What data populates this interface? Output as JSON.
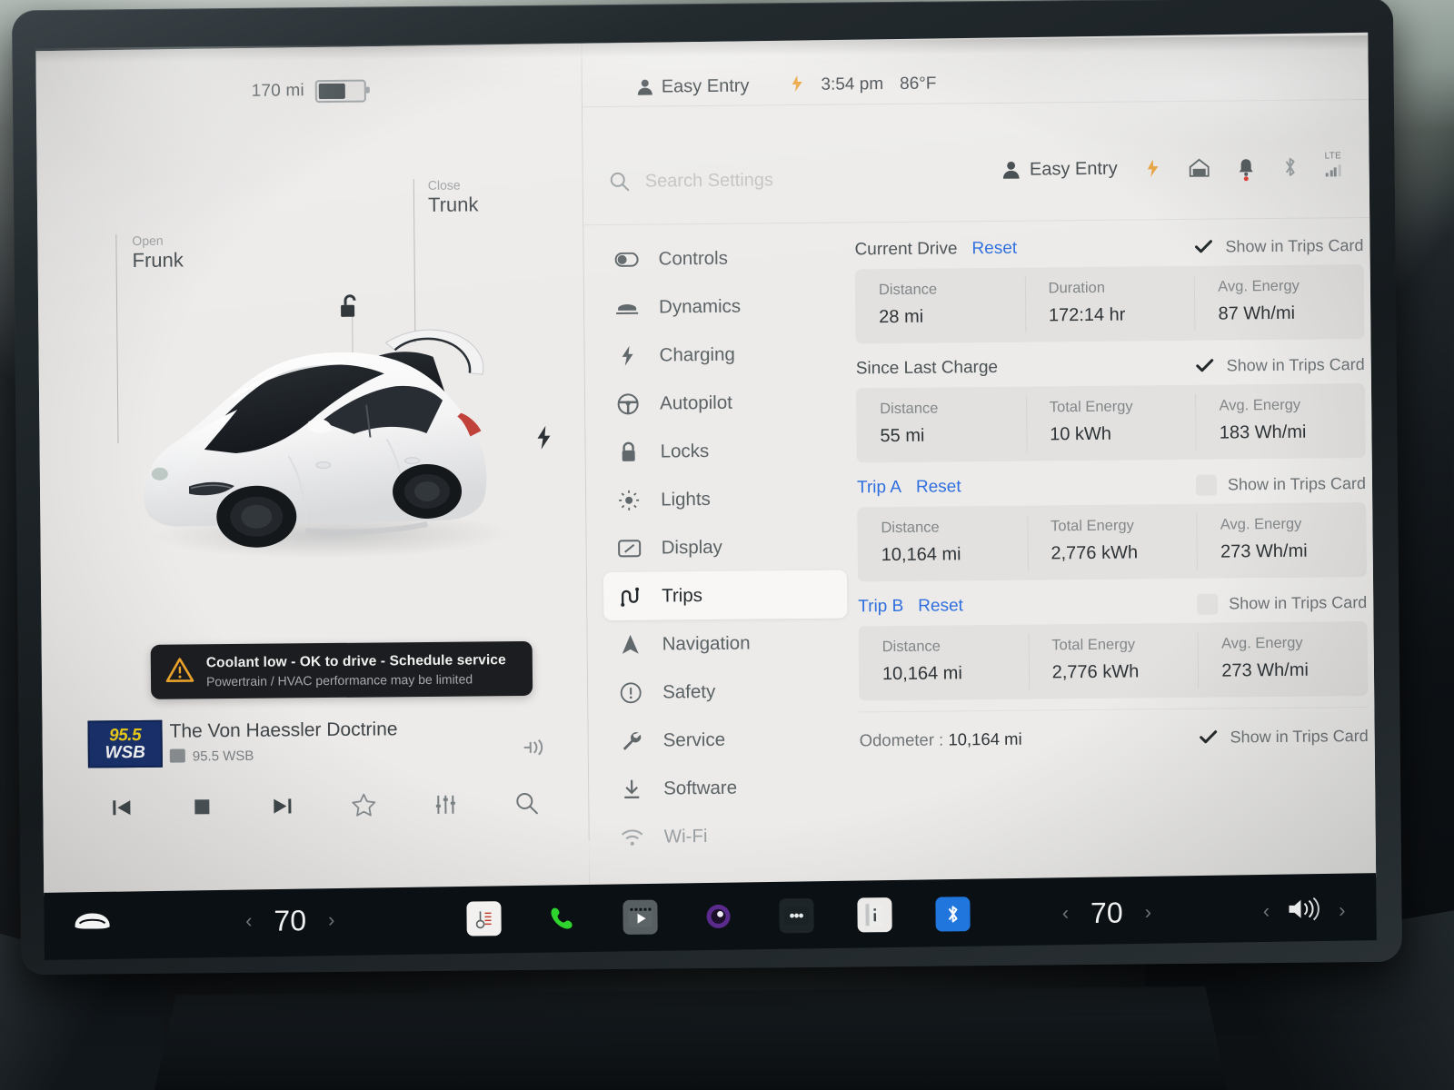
{
  "vehicle_status": {
    "range": "170 mi",
    "battery_percent": 55
  },
  "car_view": {
    "frunk": {
      "action": "Open",
      "label": "Frunk"
    },
    "trunk": {
      "action": "Close",
      "label": "Trunk"
    },
    "lock_icon": "unlocked-padlock-icon",
    "charge_icon": "charge-port-bolt-icon"
  },
  "alert": {
    "title": "Coolant low - OK to drive - Schedule service",
    "subtitle": "Powertrain / HVAC performance may be limited",
    "icon": "warning-triangle-icon",
    "icon_color": "#f0a62a"
  },
  "media": {
    "station_logo_top": "95.5",
    "station_logo_bottom": "WSB",
    "logo_bg": "#17306e",
    "logo_top_color": "#f7d417",
    "track_title": "The Von Haessler Doctrine",
    "station_name": "95.5 WSB",
    "controls": [
      {
        "name": "previous-track-button",
        "icon": "skip-previous-icon"
      },
      {
        "name": "stop-button",
        "icon": "stop-square-icon"
      },
      {
        "name": "next-track-button",
        "icon": "skip-next-icon"
      },
      {
        "name": "favorite-button",
        "icon": "star-outline-icon"
      },
      {
        "name": "equalizer-button",
        "icon": "sliders-icon"
      },
      {
        "name": "search-media-button",
        "icon": "search-icon"
      }
    ],
    "source_icon": "audio-source-icon"
  },
  "status_bar": {
    "profile": "Easy Entry",
    "clock": "3:54 pm",
    "outside_temp": "86°F",
    "icons": [
      "person-icon",
      "charge-cable-icon",
      "garage-door-icon",
      "bell-icon",
      "bluetooth-icon",
      "lte-signal-icon"
    ],
    "lte_label": "LTE"
  },
  "search": {
    "placeholder": "Search Settings",
    "icon": "search-icon"
  },
  "nav": {
    "items": [
      {
        "label": "Controls",
        "icon": "toggle-switch-icon",
        "active": false,
        "faded": false
      },
      {
        "label": "Dynamics",
        "icon": "car-suspension-icon",
        "active": false,
        "faded": false
      },
      {
        "label": "Charging",
        "icon": "lightning-bolt-icon",
        "active": false,
        "faded": false
      },
      {
        "label": "Autopilot",
        "icon": "steering-wheel-icon",
        "active": false,
        "faded": false
      },
      {
        "label": "Locks",
        "icon": "padlock-icon",
        "active": false,
        "faded": false
      },
      {
        "label": "Lights",
        "icon": "sun-lights-icon",
        "active": false,
        "faded": false
      },
      {
        "label": "Display",
        "icon": "screen-icon",
        "active": false,
        "faded": false
      },
      {
        "label": "Trips",
        "icon": "winding-road-icon",
        "active": true,
        "faded": false
      },
      {
        "label": "Navigation",
        "icon": "navigation-arrow-icon",
        "active": false,
        "faded": false
      },
      {
        "label": "Safety",
        "icon": "exclamation-circle-icon",
        "active": false,
        "faded": false
      },
      {
        "label": "Service",
        "icon": "wrench-icon",
        "active": false,
        "faded": false
      },
      {
        "label": "Software",
        "icon": "download-icon",
        "active": false,
        "faded": false
      },
      {
        "label": "Wi-Fi",
        "icon": "wifi-icon",
        "active": false,
        "faded": true
      }
    ]
  },
  "trips": {
    "show_in_trips_card_label": "Show in Trips Card",
    "reset_label": "Reset",
    "sections": [
      {
        "title": "Current Drive",
        "title_is_link": false,
        "has_reset": true,
        "show_in_trips_card": true,
        "stats": [
          {
            "key": "Distance",
            "value": "28 mi"
          },
          {
            "key": "Duration",
            "value": "172:14 hr"
          },
          {
            "key": "Avg. Energy",
            "value": "87 Wh/mi"
          }
        ]
      },
      {
        "title": "Since Last Charge",
        "title_is_link": false,
        "has_reset": false,
        "show_in_trips_card": true,
        "stats": [
          {
            "key": "Distance",
            "value": "55 mi"
          },
          {
            "key": "Total Energy",
            "value": "10 kWh"
          },
          {
            "key": "Avg. Energy",
            "value": "183 Wh/mi"
          }
        ]
      },
      {
        "title": "Trip A",
        "title_is_link": true,
        "has_reset": true,
        "show_in_trips_card": false,
        "stats": [
          {
            "key": "Distance",
            "value": "10,164 mi"
          },
          {
            "key": "Total Energy",
            "value": "2,776 kWh"
          },
          {
            "key": "Avg. Energy",
            "value": "273 Wh/mi"
          }
        ]
      },
      {
        "title": "Trip B",
        "title_is_link": true,
        "has_reset": true,
        "show_in_trips_card": false,
        "stats": [
          {
            "key": "Distance",
            "value": "10,164 mi"
          },
          {
            "key": "Total Energy",
            "value": "2,776 kWh"
          },
          {
            "key": "Avg. Energy",
            "value": "273 Wh/mi"
          }
        ]
      }
    ],
    "odometer_label": "Odometer :",
    "odometer_value": "10,164 mi",
    "odometer_show_in_trips_card": true
  },
  "taskbar": {
    "driver_temp": "70",
    "passenger_temp": "70",
    "car_icon": "car-front-icon",
    "volume_icon": "speaker-volume-icon",
    "apps": [
      {
        "name": "climate-app",
        "icon": "thermostat-icon"
      },
      {
        "name": "phone-app",
        "icon": "phone-handset-icon"
      },
      {
        "name": "media-app",
        "icon": "film-play-icon"
      },
      {
        "name": "tesla-app",
        "icon": "circle-eye-icon"
      },
      {
        "name": "more-apps",
        "icon": "ellipsis-icon"
      },
      {
        "name": "energy-app",
        "icon": "info-card-icon"
      },
      {
        "name": "bluetooth-app",
        "icon": "bluetooth-icon"
      }
    ]
  },
  "colors": {
    "accent_blue": "#2f6ede",
    "screen_bg": "#ecebe9",
    "card_bg": "#e3e1df",
    "taskbar_bg": "#0b1014",
    "alert_bg": "#1b1d20",
    "warning": "#f0a62a"
  }
}
